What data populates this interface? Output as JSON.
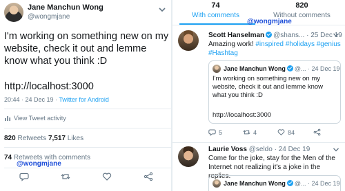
{
  "left_tweet": {
    "author_name": "Jane Manchun Wong",
    "author_handle": "@wongmjane",
    "body": "I'm working on something new on my website, check it out and lemme know what you think :D",
    "url": "http://localhost:3000",
    "time": "20:44 · 24 Dec 19 · ",
    "client": "Twitter for Android",
    "activity_label": "View Tweet activity",
    "retweets_count": "820",
    "retweets_label": " Retweets  ",
    "likes_count": "7,517",
    "likes_label": " Likes",
    "comments_count": "74",
    "comments_label": " Retweets with comments",
    "watermark": "@wongmjane"
  },
  "tabs": [
    {
      "count": "74",
      "label": "With comments",
      "active": true
    },
    {
      "count": "820",
      "label": "Without comments",
      "active": false
    }
  ],
  "tabs_watermark": "@wongmjane",
  "quote_tweet_1": {
    "author_name": "Scott Hanselman",
    "meta": "@shans... · 25 Dec 19",
    "text_plain": "Amazing work! ",
    "hashtags": "#inspired #holidays #genius #Hashtag",
    "quoted": {
      "author_name": "Jane Manchun Wong",
      "meta": "@... · 24 Dec 19",
      "text": "I'm working on something new on my website, check it out and lemme know what you think :D",
      "url": "http://localhost:3000"
    },
    "replies": "5",
    "retweets": "4",
    "likes": "84"
  },
  "quote_tweet_2": {
    "author_name": "Laurie Voss",
    "meta": "@seldo · 24 Dec 19",
    "text": "Come for the joke, stay for the Men of the Internet not realizing it's a joke in the replies.",
    "quoted": {
      "author_name": "Jane Manchun Wong",
      "meta": "@... · 24 Dec 19"
    }
  },
  "colors": {
    "link": "#1da1f2",
    "muted": "#657786",
    "text": "#14171a",
    "like": "#e0245e"
  },
  "icons": [
    "caret-down-icon",
    "reply-icon",
    "retweet-icon",
    "like-icon",
    "share-icon",
    "activity-icon",
    "verified-icon"
  ]
}
